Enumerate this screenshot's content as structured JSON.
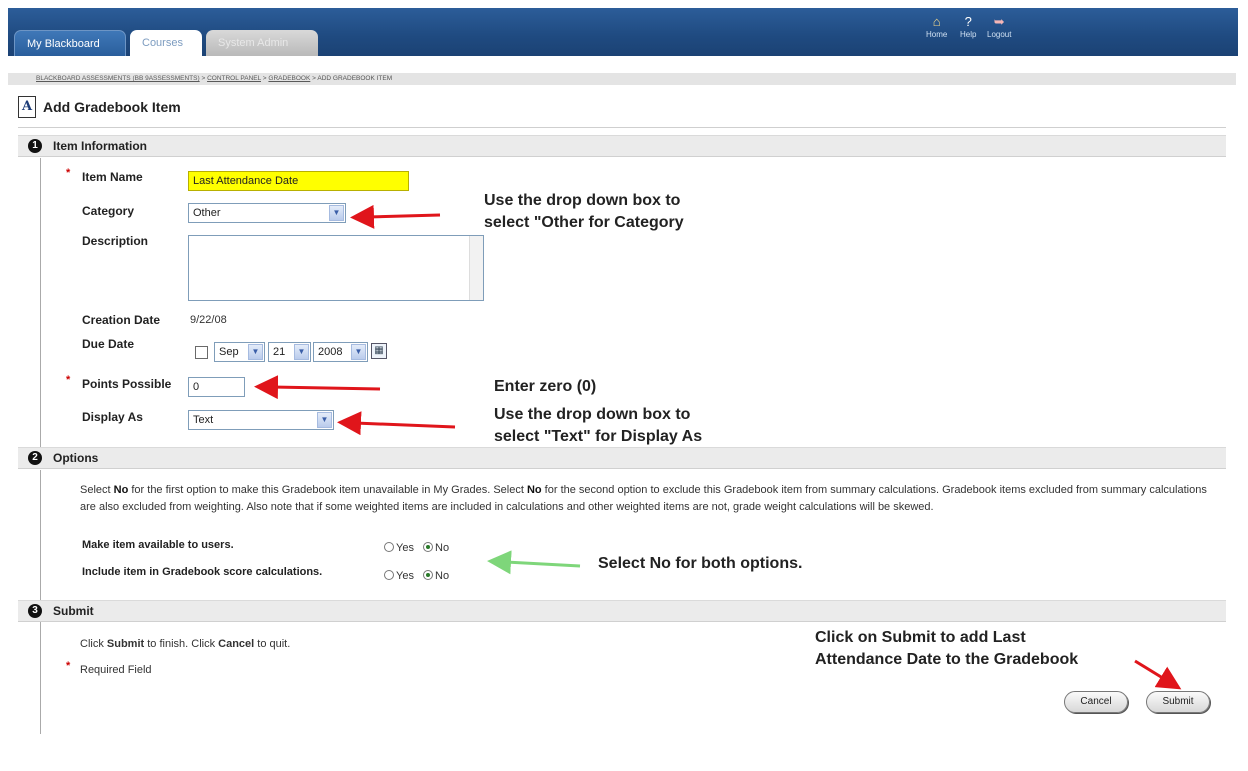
{
  "nav": {
    "tabs": [
      {
        "label": "My Blackboard"
      },
      {
        "label": "Courses"
      },
      {
        "label": "System Admin"
      }
    ],
    "utility": [
      {
        "label": "Home",
        "icon": "home-icon"
      },
      {
        "label": "Help",
        "icon": "help-icon"
      },
      {
        "label": "Logout",
        "icon": "logout-icon"
      }
    ]
  },
  "breadcrumb": {
    "items": [
      "BLACKBOARD ASSESSMENTS (BB 9ASSESSMENTS)",
      "CONTROL PANEL",
      "GRADEBOOK",
      "ADD GRADEBOOK ITEM"
    ],
    "separator": " > "
  },
  "page": {
    "title": "Add Gradebook Item"
  },
  "sections": [
    {
      "number": "1",
      "title": "Item Information"
    },
    {
      "number": "2",
      "title": "Options"
    },
    {
      "number": "3",
      "title": "Submit"
    }
  ],
  "item_info": {
    "item_name_label": "Item Name",
    "item_name_value": "Last Attendance Date",
    "category_label": "Category",
    "category_value": "Other",
    "description_label": "Description",
    "creation_date_label": "Creation Date",
    "creation_date_value": "9/22/08",
    "due_date_label": "Due Date",
    "due_month": "Sep",
    "due_day": "21",
    "due_year": "2008",
    "points_label": "Points Possible",
    "points_value": "0",
    "display_as_label": "Display As",
    "display_as_value": "Text"
  },
  "options": {
    "intro_parts": [
      "Select ",
      "No",
      " for the first option to make this Gradebook item unavailable in My Grades. Select ",
      "No",
      " for the second option to exclude this Gradebook item from summary calculations. Gradebook items excluded from summary calculations are also excluded from weighting. Also note that if some weighted items are included in calculations and other weighted items are not, grade weight calculations will be skewed."
    ],
    "available_label": "Make item available to users.",
    "include_label": "Include item in Gradebook score calculations.",
    "yes_label": "Yes",
    "no_label": "No",
    "available_selected": "No",
    "include_selected": "No"
  },
  "submit": {
    "intro_parts": [
      "Click ",
      "Submit",
      " to finish. Click ",
      "Cancel",
      " to quit."
    ],
    "required_note": "Required Field",
    "required_marker": "*",
    "cancel_label": "Cancel",
    "submit_label": "Submit"
  },
  "annotations": {
    "category": [
      "Use the drop down box to",
      "select \"Other for Category"
    ],
    "points": [
      "Enter zero (0)"
    ],
    "display": [
      "Use the drop down box to",
      "select \"Text\" for Display As"
    ],
    "options": [
      "Select No for both options."
    ],
    "submit": [
      "Click on Submit to add Last",
      "Attendance Date to the Gradebook"
    ]
  },
  "colors": {
    "nav_blue": "#1f4a80",
    "highlight_yellow": "#ffff00",
    "arrow_red": "#e0151b",
    "arrow_green": "#7ed67a",
    "required_red": "#cc0000"
  }
}
